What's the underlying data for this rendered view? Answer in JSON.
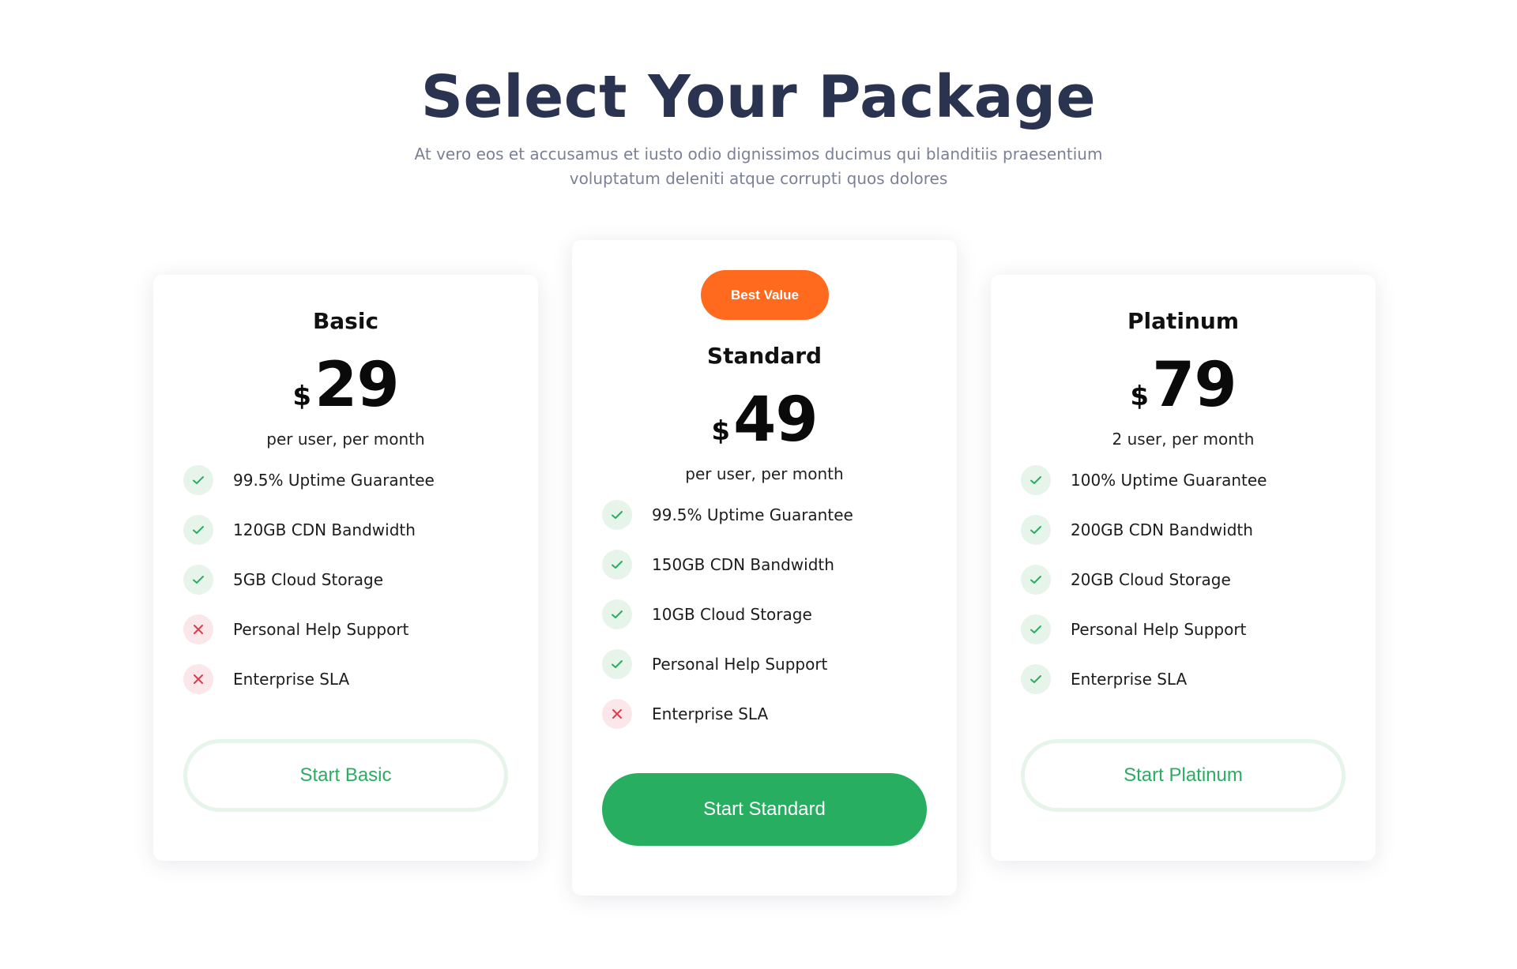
{
  "header": {
    "title": "Select Your Package",
    "subtitle": "At vero eos et accusamus et iusto odio dignissimos ducimus qui blanditiis praesentium voluptatum deleniti atque corrupti quos dolores"
  },
  "colors": {
    "title": "#2a3350",
    "accent_green": "#27ae60",
    "badge_orange": "#ff6a1f",
    "check_bg": "#e7f4ea",
    "cross_bg": "#fbe7e9",
    "cross": "#e03a4a"
  },
  "plans": [
    {
      "name": "Basic",
      "currency": "$",
      "price": "29",
      "period": "per user, per month",
      "features": [
        {
          "label": "99.5% Uptime Guarantee",
          "included": true,
          "icon": "check-icon"
        },
        {
          "label": "120GB CDN Bandwidth",
          "included": true,
          "icon": "check-icon"
        },
        {
          "label": "5GB Cloud Storage",
          "included": true,
          "icon": "check-icon"
        },
        {
          "label": "Personal Help Support",
          "included": false,
          "icon": "x-icon"
        },
        {
          "label": "Enterprise SLA",
          "included": false,
          "icon": "x-icon"
        }
      ],
      "cta": "Start Basic"
    },
    {
      "name": "Standard",
      "badge": "Best Value",
      "currency": "$",
      "price": "49",
      "period": "per user, per month",
      "features": [
        {
          "label": "99.5% Uptime Guarantee",
          "included": true,
          "icon": "check-icon"
        },
        {
          "label": "150GB CDN Bandwidth",
          "included": true,
          "icon": "check-icon"
        },
        {
          "label": "10GB Cloud Storage",
          "included": true,
          "icon": "check-icon"
        },
        {
          "label": "Personal Help Support",
          "included": true,
          "icon": "check-icon"
        },
        {
          "label": "Enterprise SLA",
          "included": false,
          "icon": "x-icon"
        }
      ],
      "cta": "Start Standard"
    },
    {
      "name": "Platinum",
      "currency": "$",
      "price": "79",
      "period": "2 user, per month",
      "features": [
        {
          "label": "100% Uptime Guarantee",
          "included": true,
          "icon": "check-icon"
        },
        {
          "label": "200GB CDN Bandwidth",
          "included": true,
          "icon": "check-icon"
        },
        {
          "label": "20GB Cloud Storage",
          "included": true,
          "icon": "check-icon"
        },
        {
          "label": "Personal Help Support",
          "included": true,
          "icon": "check-icon"
        },
        {
          "label": "Enterprise SLA",
          "included": true,
          "icon": "check-icon"
        }
      ],
      "cta": "Start Platinum"
    }
  ]
}
